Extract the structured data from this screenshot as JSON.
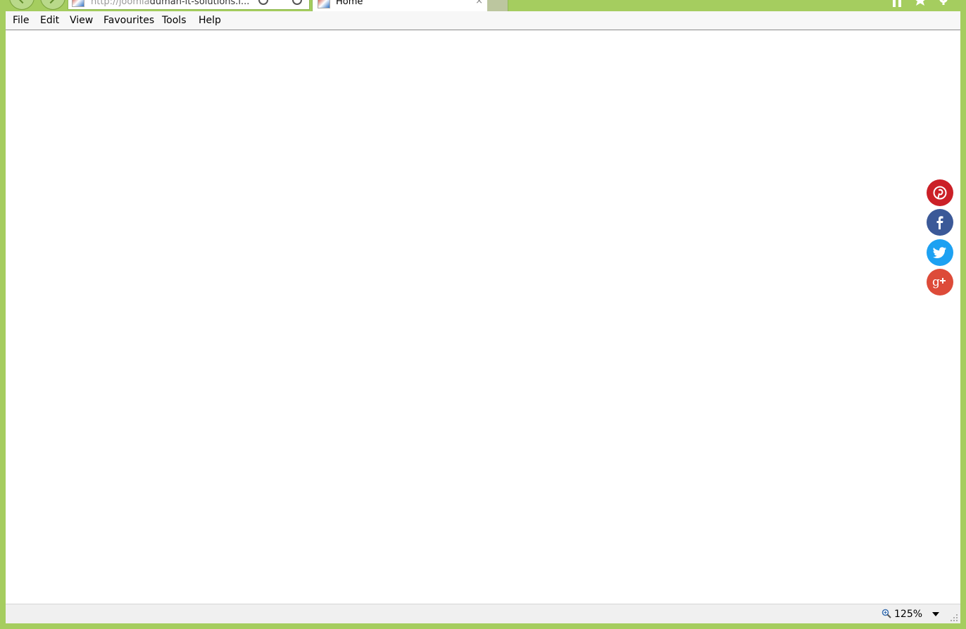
{
  "browser": {
    "address": {
      "url_prefix": "http://joomla",
      "url_rest": "duman-it-solutions.i..."
    },
    "tab": {
      "title": "Home",
      "close_glyph": "×"
    },
    "icons": {
      "home": "home-icon",
      "favourites": "star-icon",
      "tools": "gear-icon"
    },
    "theme_color": "#a5cd5f"
  },
  "menu": {
    "items": [
      {
        "label": "File"
      },
      {
        "label": "Edit"
      },
      {
        "label": "View"
      },
      {
        "label": "Favourites"
      },
      {
        "label": "Tools"
      },
      {
        "label": "Help"
      }
    ]
  },
  "social": {
    "buttons": [
      {
        "name": "pinterest",
        "color": "#cb2027"
      },
      {
        "name": "facebook",
        "color": "#3b5998"
      },
      {
        "name": "twitter",
        "color": "#1da1f2"
      },
      {
        "name": "google-plus",
        "color": "#dd4b39"
      }
    ]
  },
  "status_bar": {
    "zoom": "125%"
  }
}
